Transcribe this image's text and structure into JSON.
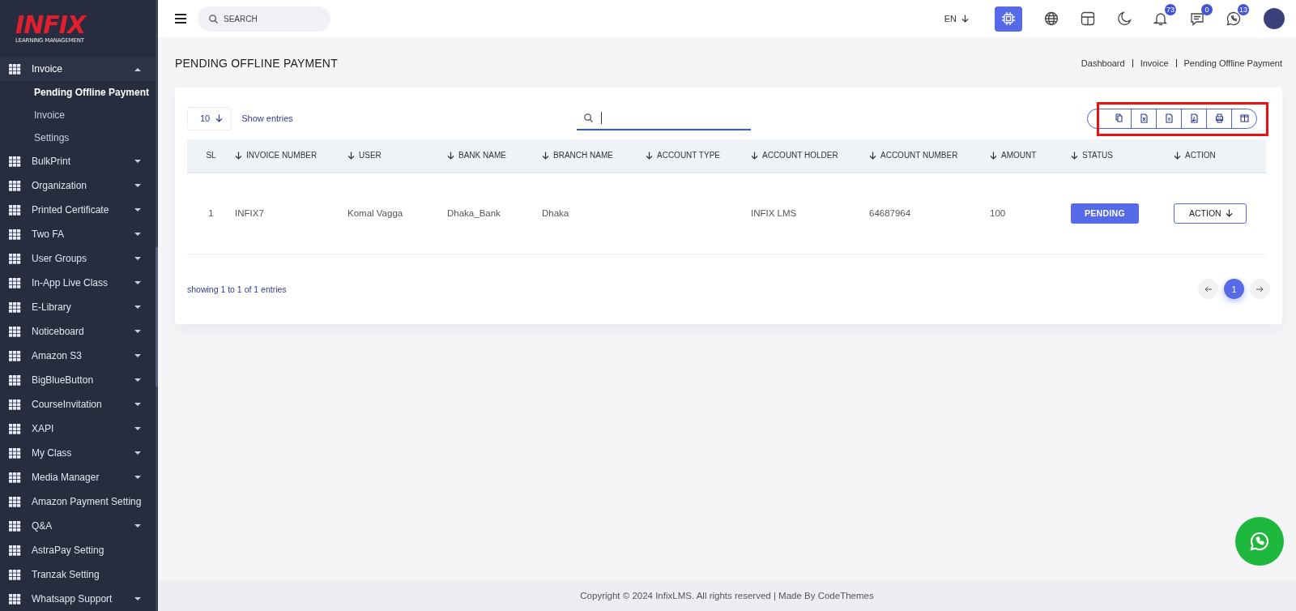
{
  "logo": {
    "name": "INFIX",
    "tagline": "LEARNING MANAGEMENT"
  },
  "sidebar": {
    "items": [
      {
        "label": "Invoice",
        "has_submenu": true,
        "expanded": true,
        "children": [
          {
            "label": "Pending Offline Payment",
            "selected": true
          },
          {
            "label": "Invoice",
            "selected": false
          },
          {
            "label": "Settings",
            "selected": false
          }
        ]
      },
      {
        "label": "BulkPrint",
        "has_submenu": true,
        "expanded": false
      },
      {
        "label": "Organization",
        "has_submenu": true,
        "expanded": false
      },
      {
        "label": "Printed Certificate",
        "has_submenu": true,
        "expanded": false
      },
      {
        "label": "Two FA",
        "has_submenu": true,
        "expanded": false
      },
      {
        "label": "User Groups",
        "has_submenu": true,
        "expanded": false
      },
      {
        "label": "In-App Live Class",
        "has_submenu": true,
        "expanded": false
      },
      {
        "label": "E-Library",
        "has_submenu": true,
        "expanded": false
      },
      {
        "label": "Noticeboard",
        "has_submenu": true,
        "expanded": false
      },
      {
        "label": "Amazon S3",
        "has_submenu": true,
        "expanded": false
      },
      {
        "label": "BigBlueButton",
        "has_submenu": true,
        "expanded": false
      },
      {
        "label": "CourseInvitation",
        "has_submenu": true,
        "expanded": false
      },
      {
        "label": "XAPI",
        "has_submenu": true,
        "expanded": false
      },
      {
        "label": "My Class",
        "has_submenu": true,
        "expanded": false
      },
      {
        "label": "Media Manager",
        "has_submenu": true,
        "expanded": false
      },
      {
        "label": "Amazon Payment Setting",
        "has_submenu": false,
        "expanded": false
      },
      {
        "label": "Q&A",
        "has_submenu": true,
        "expanded": false
      },
      {
        "label": "AstraPay Setting",
        "has_submenu": false,
        "expanded": false
      },
      {
        "label": "Tranzak Setting",
        "has_submenu": false,
        "expanded": false
      },
      {
        "label": "Whatsapp Support",
        "has_submenu": true,
        "expanded": false
      }
    ]
  },
  "topbar": {
    "search": {
      "placeholder": "SEARCH"
    },
    "language": "EN",
    "icons": [
      {
        "kind": "chip",
        "selected": true
      },
      {
        "kind": "globe",
        "selected": false
      },
      {
        "kind": "layout",
        "selected": false
      },
      {
        "kind": "moon",
        "selected": false
      },
      {
        "kind": "bell",
        "badge": "73",
        "selected": false
      },
      {
        "kind": "chat",
        "badge": "0",
        "selected": false
      },
      {
        "kind": "whatsapp",
        "badge": "13",
        "selected": false
      }
    ]
  },
  "page": {
    "title": "PENDING OFFLINE PAYMENT",
    "breadcrumb": [
      "Dashboard",
      "Invoice",
      "Pending Offline Payment"
    ]
  },
  "table_card": {
    "page_length": "10",
    "page_length_label": "Show entries",
    "export_toolbar": {
      "highlighted": true,
      "buttons": [
        {
          "kind": "copy"
        },
        {
          "kind": "excel"
        },
        {
          "kind": "csv"
        },
        {
          "kind": "pdf"
        },
        {
          "kind": "print"
        },
        {
          "kind": "columns"
        }
      ]
    },
    "columns": [
      {
        "label": "SL",
        "sortable": false
      },
      {
        "label": "INVOICE NUMBER",
        "sortable": true
      },
      {
        "label": "USER",
        "sortable": true
      },
      {
        "label": "BANK NAME",
        "sortable": true
      },
      {
        "label": "BRANCH NAME",
        "sortable": true
      },
      {
        "label": "ACCOUNT TYPE",
        "sortable": true
      },
      {
        "label": "ACCOUNT HOLDER",
        "sortable": true
      },
      {
        "label": "ACCOUNT NUMBER",
        "sortable": true
      },
      {
        "label": "AMOUNT",
        "sortable": true
      },
      {
        "label": "STATUS",
        "sortable": true
      },
      {
        "label": "ACTION",
        "sortable": true
      }
    ],
    "rows": [
      {
        "cells": [
          "1",
          "INFIX7",
          "Komal Vagga",
          "Dhaka_Bank",
          "Dhaka",
          null,
          "INFIX LMS",
          "64687964",
          "100"
        ],
        "status": "PENDING",
        "action": "ACTION"
      }
    ],
    "info": "showing 1 to 1 of 1 entries",
    "pagination": {
      "pages": [
        {
          "label": "1",
          "selected": true
        }
      ]
    }
  },
  "footer": {
    "text": "Copyright © 2024 InfixLMS. All rights reserved | Made By CodeThemes"
  }
}
